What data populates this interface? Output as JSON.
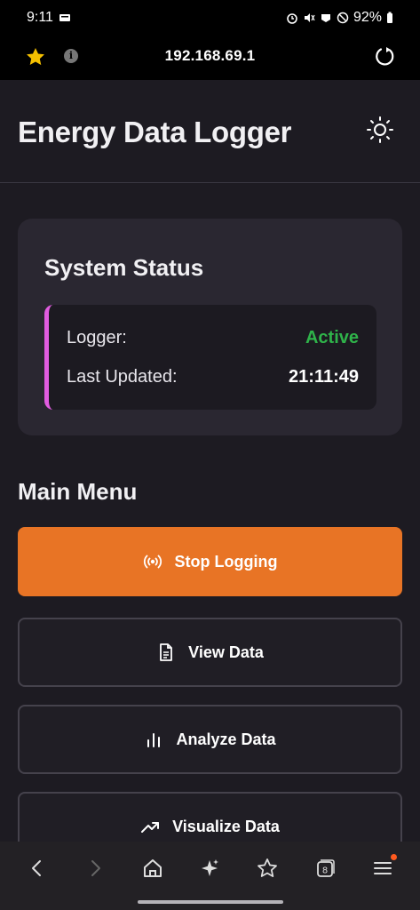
{
  "status_bar": {
    "time": "9:11",
    "battery": "92%",
    "icons": [
      "notification-icon",
      "alarm-icon",
      "mute-icon",
      "data-icon",
      "dnd-icon",
      "battery-icon"
    ]
  },
  "browser": {
    "url": "192.168.69.1",
    "icons": [
      "star-icon",
      "info-icon",
      "reload-icon"
    ]
  },
  "header": {
    "title": "Energy Data Logger",
    "theme_icon": "sun-icon"
  },
  "status_card": {
    "title": "System Status",
    "logger_label": "Logger:",
    "logger_value": "Active",
    "updated_label": "Last Updated:",
    "updated_value": "21:11:49"
  },
  "menu": {
    "title": "Main Menu",
    "buttons": [
      {
        "label": "Stop Logging",
        "icon": "broadcast-icon"
      },
      {
        "label": "View Data",
        "icon": "document-icon"
      },
      {
        "label": "Analyze Data",
        "icon": "bar-chart-icon"
      },
      {
        "label": "Visualize Data",
        "icon": "trending-up-icon"
      }
    ]
  },
  "nav": {
    "items": [
      "back-icon",
      "forward-icon",
      "home-icon",
      "sparkle-icon",
      "bookmarks-icon",
      "tabs-icon",
      "menu-icon"
    ],
    "tab_count": "8"
  },
  "colors": {
    "accent": "#e87425",
    "active": "#2fb34a",
    "status_border": "#e15ce0",
    "background": "#1d1b22"
  }
}
